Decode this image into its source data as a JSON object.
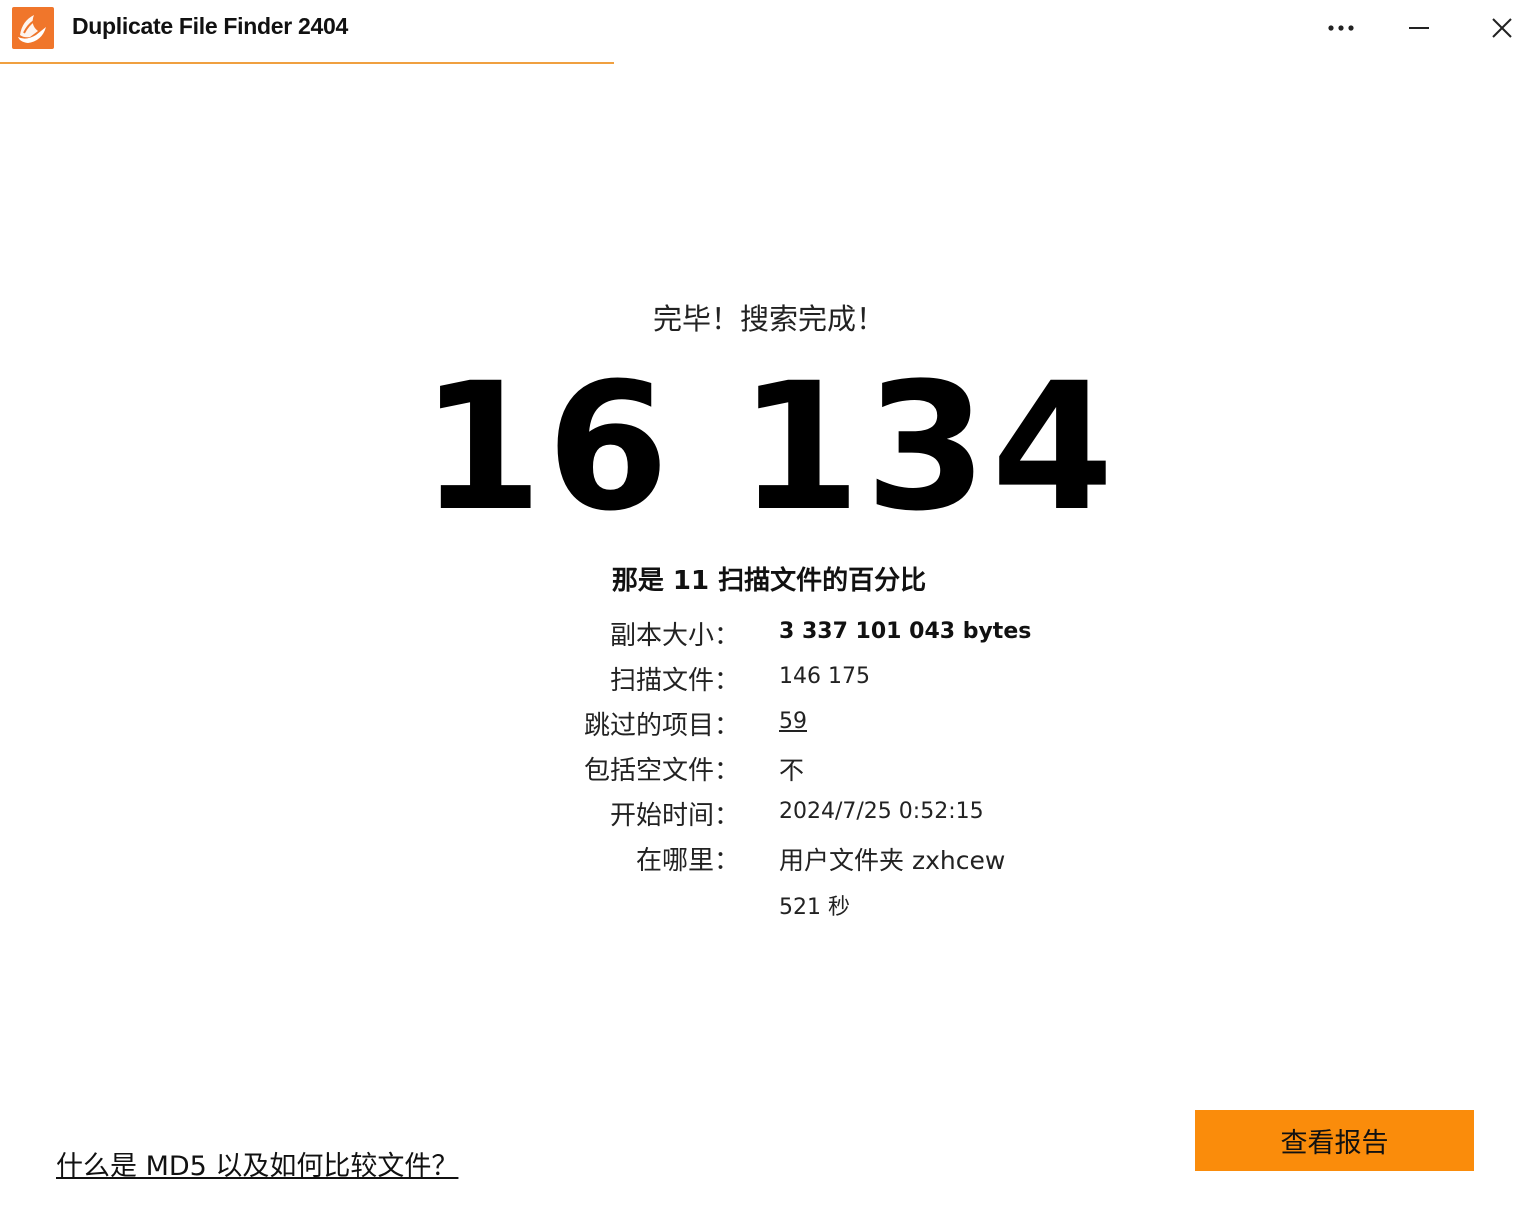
{
  "window": {
    "title": "Duplicate File Finder 2404",
    "accent_color": "#fa8c0b",
    "icon_color": "#f0762b"
  },
  "titlebar_buttons": {
    "more_icon": "more-dots-icon",
    "minimize_icon": "minimize-icon",
    "close_icon": "close-icon"
  },
  "result": {
    "status_text": "完毕！搜索完成！",
    "duplicate_count": "16 134",
    "percent_text": "那是 11 扫描文件的百分比"
  },
  "stats": [
    {
      "label": "副本大小：",
      "value": "3 337 101 043 bytes",
      "style": "bold"
    },
    {
      "label": "扫描文件：",
      "value": "146 175",
      "style": "normal"
    },
    {
      "label": "跳过的项目：",
      "value": "59",
      "style": "link"
    },
    {
      "label": "包括空文件：",
      "value": "不",
      "style": "cjk"
    },
    {
      "label": "开始时间：",
      "value": "2024/7/25 0:52:15",
      "style": "normal"
    },
    {
      "label": "在哪里：",
      "value": "用户文件夹 zxhcew",
      "style": "cjk"
    },
    {
      "label": "",
      "value": "521 秒",
      "style": "normal"
    }
  ],
  "footer": {
    "md5_link": "什么是 MD5 以及如何比较文件？",
    "report_button": "查看报告"
  }
}
